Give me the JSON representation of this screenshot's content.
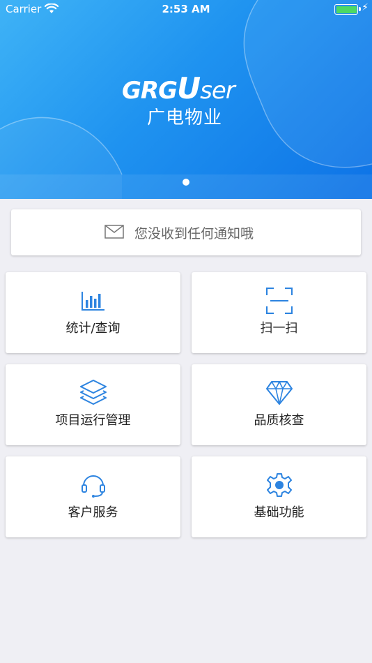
{
  "status_bar": {
    "carrier": "Carrier",
    "time": "2:53 AM"
  },
  "banner": {
    "brand_prefix": "GRG",
    "brand_u": "U",
    "brand_suffix": "ser",
    "company_cn": "广电物业",
    "page_dots": 1
  },
  "notice": {
    "text": "您没收到任何通知哦",
    "icon": "mail-icon"
  },
  "menu": {
    "items": [
      {
        "label": "统计/查询",
        "icon": "bar-chart-icon"
      },
      {
        "label": "扫一扫",
        "icon": "scan-icon"
      },
      {
        "label": "项目运行管理",
        "icon": "layers-icon"
      },
      {
        "label": "品质核查",
        "icon": "diamond-icon"
      },
      {
        "label": "客户服务",
        "icon": "headset-icon"
      },
      {
        "label": "基础功能",
        "icon": "gear-icon"
      }
    ]
  },
  "colors": {
    "accent": "#2d84e0",
    "banner_start": "#3fb3f6",
    "banner_end": "#0d72e6",
    "background": "#efeff4"
  }
}
